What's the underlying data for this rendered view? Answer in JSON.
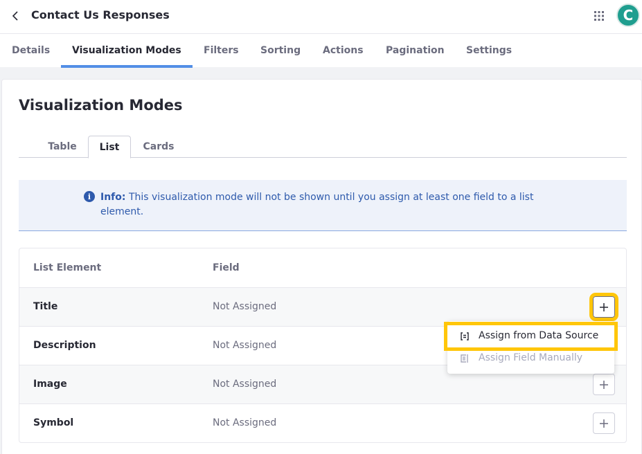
{
  "header": {
    "title": "Contact Us Responses",
    "avatar_letter": "C",
    "avatar_color": "#1f9e8f"
  },
  "nav_tabs": [
    {
      "label": "Details"
    },
    {
      "label": "Visualization Modes",
      "active": true
    },
    {
      "label": "Filters"
    },
    {
      "label": "Sorting"
    },
    {
      "label": "Actions"
    },
    {
      "label": "Pagination"
    },
    {
      "label": "Settings"
    }
  ],
  "main": {
    "title": "Visualization Modes",
    "sub_tabs": [
      {
        "label": "Table"
      },
      {
        "label": "List",
        "active": true
      },
      {
        "label": "Cards"
      }
    ],
    "info": {
      "label": "Info:",
      "text": "This visualization mode will not be shown until you assign at least one field to a list element."
    },
    "table": {
      "headers": {
        "element": "List Element",
        "field": "Field"
      },
      "rows": [
        {
          "element": "Title",
          "field": "Not Assigned"
        },
        {
          "element": "Description",
          "field": "Not Assigned"
        },
        {
          "element": "Image",
          "field": "Not Assigned"
        },
        {
          "element": "Symbol",
          "field": "Not Assigned"
        }
      ]
    },
    "dropdown": {
      "items": [
        {
          "label": "Assign from Data Source",
          "icon": "data-source-icon"
        },
        {
          "label": "Assign Field Manually",
          "icon": "manual-field-icon"
        }
      ]
    }
  },
  "colors": {
    "accent": "#528ee6",
    "highlight": "#ffc60a",
    "info_text": "#2e5aac"
  }
}
